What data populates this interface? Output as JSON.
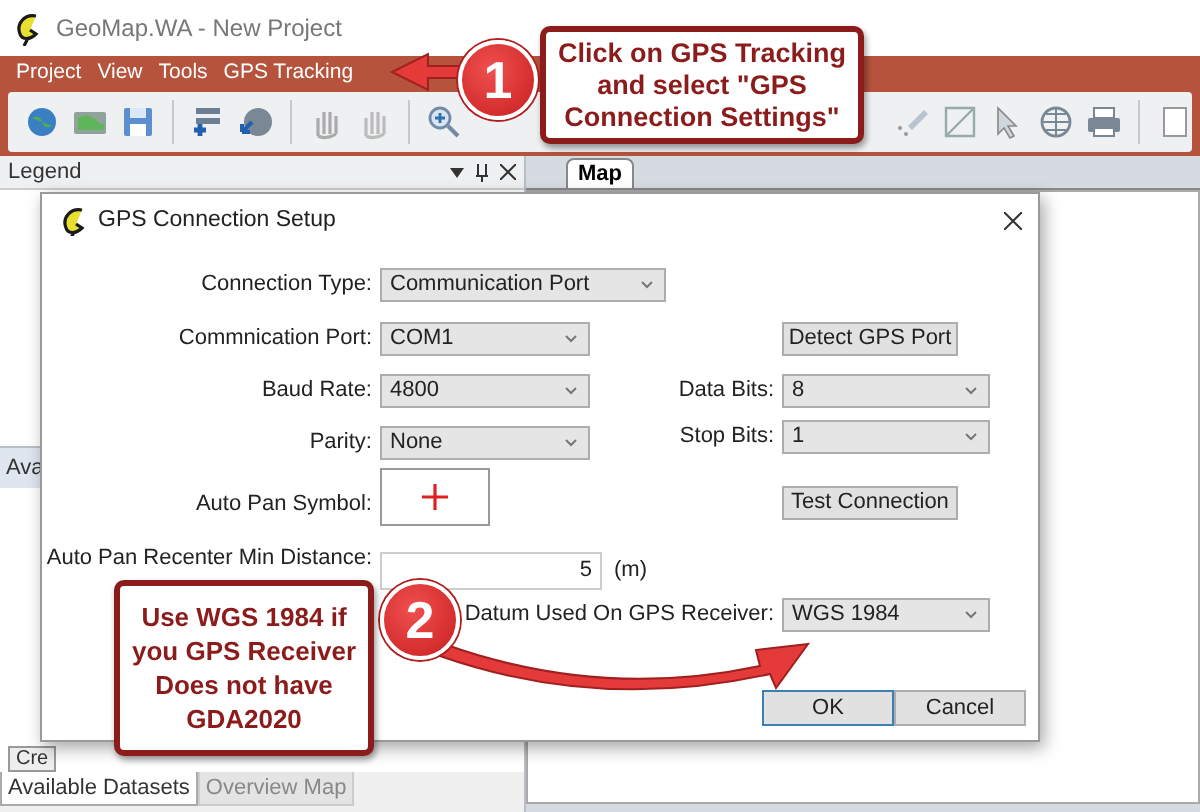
{
  "window": {
    "title": "GeoMap.WA - New Project"
  },
  "menu": [
    "Project",
    "View",
    "Tools",
    "GPS Tracking"
  ],
  "legend_panel": {
    "title": "Legend",
    "tab_peek": "Ava",
    "button_peek": "Cre"
  },
  "map_tab": "Map",
  "bottom_tabs": [
    {
      "label": "Available Datasets",
      "selected": true
    },
    {
      "label": "Overview Map",
      "selected": false
    }
  ],
  "dialog": {
    "title": "GPS Connection Setup",
    "connection_type": {
      "label": "Connection Type:",
      "value": "Communication Port"
    },
    "port": {
      "label": "Commnication Port:",
      "value": "COM1"
    },
    "baud_rate": {
      "label": "Baud Rate:",
      "value": "4800"
    },
    "parity": {
      "label": "Parity:",
      "value": "None"
    },
    "auto_pan_symbol": {
      "label": "Auto Pan Symbol:"
    },
    "distance": {
      "label": "Auto Pan Recenter Min Distance:",
      "value": "5",
      "unit": "(m)"
    },
    "detect_button": "Detect GPS Port",
    "data_bits": {
      "label": "Data Bits:",
      "value": "8"
    },
    "stop_bits": {
      "label": "Stop Bits:",
      "value": "1"
    },
    "test_button": "Test Connection",
    "datum": {
      "label": "Datum Used On GPS Receiver:",
      "value": "WGS 1984"
    },
    "ok_button": "OK",
    "cancel_button": "Cancel"
  },
  "callouts": [
    {
      "number": "1",
      "text": "Click on GPS Tracking and select \"GPS Connection Settings\""
    },
    {
      "number": "2",
      "text": "Use WGS 1984 if you GPS Receiver Does not have GDA2020"
    }
  ]
}
